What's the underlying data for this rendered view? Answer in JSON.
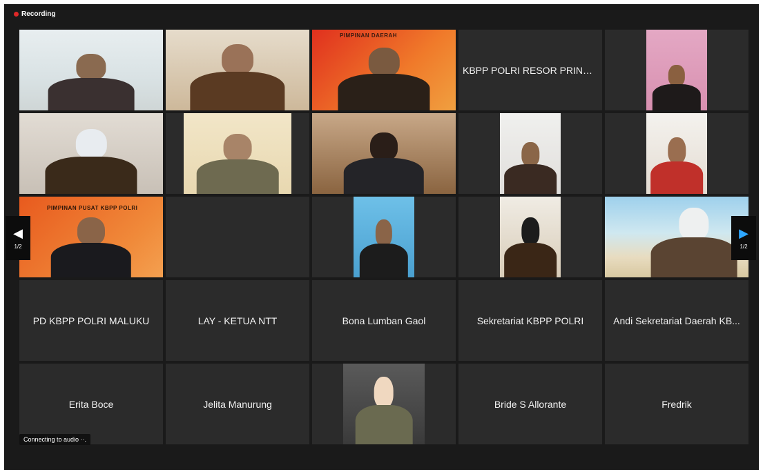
{
  "recording": {
    "label": "Recording",
    "color": "#e02828"
  },
  "colors": {
    "active_speaker": "#c9e06b",
    "tile_bg": "#2b2b2b",
    "window_bg": "#1a1a1a",
    "nav_arrow_right": "#2ea7ff"
  },
  "banners": {
    "t3": "PIMPINAN DAERAH",
    "t11": "PIMPINAN PUSAT KBPP POLRI"
  },
  "tiles": [
    {
      "name": "",
      "video": true
    },
    {
      "name": "",
      "video": true
    },
    {
      "name": "",
      "video": true
    },
    {
      "name": "KBPP POLRI RESOR PRING...",
      "video": false
    },
    {
      "name": "",
      "video": true
    },
    {
      "name": "",
      "video": true
    },
    {
      "name": "",
      "video": true
    },
    {
      "name": "",
      "video": true
    },
    {
      "name": "",
      "video": true
    },
    {
      "name": "",
      "video": true
    },
    {
      "name": "",
      "video": true
    },
    {
      "name": "",
      "video": false
    },
    {
      "name": "",
      "video": true
    },
    {
      "name": "",
      "video": true
    },
    {
      "name": "",
      "video": true
    },
    {
      "name": "PD KBPP POLRI MALUKU",
      "video": false
    },
    {
      "name": "LAY - KETUA NTT",
      "video": false
    },
    {
      "name": "Bona Lumban Gaol",
      "video": false
    },
    {
      "name": "Sekretariat KBPP POLRI",
      "video": false
    },
    {
      "name": "Andi Sekretariat Daerah KB...",
      "video": false
    },
    {
      "name": "Erita Boce",
      "video": false
    },
    {
      "name": "Jelita Manurung",
      "video": false
    },
    {
      "name": "",
      "video": true
    },
    {
      "name": "Bride S Allorante",
      "video": false
    },
    {
      "name": "Fredrik",
      "video": false
    }
  ],
  "nav": {
    "prev_page": "1/2",
    "next_page": "1/2",
    "prev_icon": "chevron-left-icon",
    "next_icon": "chevron-right-icon"
  },
  "audio_status": "Connecting to audio ··."
}
